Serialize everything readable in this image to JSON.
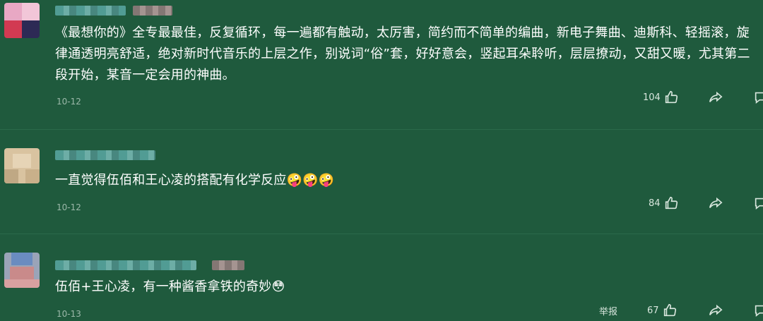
{
  "comments": [
    {
      "text": "《最想你的》全专最最佳，反复循环，每一遍都有触动，太厉害，简约而不简单的编曲，新电子舞曲、迪斯科、轻摇滚，旋律通透明亮舒适，绝对新时代音乐的上层之作，别说词“俗”套，好好意会，竖起耳朵聆听，层层撩动，又甜又暖，尤其第二段开始，某音一定会用的神曲。",
      "date": "10-12",
      "likes": "104"
    },
    {
      "text": "一直觉得伍佰和王心凌的搭配有化学反应",
      "emojis": "🤪🤪🤪",
      "date": "10-12",
      "likes": "84"
    },
    {
      "text": "伍佰+王心凌，有一种酱香拿铁的奇妙",
      "emojis": "😳",
      "date": "10-13",
      "likes": "67",
      "report": "举报"
    }
  ],
  "colors": {
    "background": "#1f5a3d",
    "text": "#ffffff",
    "meta": "#9bb8a9"
  },
  "icons": {
    "like": "thumbs-up-icon",
    "share": "share-icon",
    "comment": "comment-icon"
  }
}
